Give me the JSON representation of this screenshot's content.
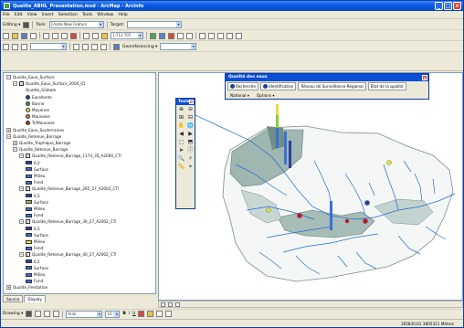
{
  "window": {
    "title": "Qualite_ABHL_Presentation.mxd - ArcMap - ArcInfo",
    "controls": [
      "_",
      "□",
      "×"
    ]
  },
  "menubar": [
    "File",
    "Edit",
    "View",
    "Insert",
    "Selection",
    "Tools",
    "Window",
    "Help"
  ],
  "toolbar_editor": {
    "editor_label": "Editing ▾",
    "task_label": "Task:",
    "task_value": "Create New Feature",
    "target_label": "Target:"
  },
  "toolbar_standard": {
    "scale_value": "1:713 707"
  },
  "toolbar_geo": {
    "georef_label": "Georeferencing ▾"
  },
  "toc": {
    "rows": [
      {
        "indent": 0,
        "expander": "−",
        "check": "",
        "label": "Qualite_Eaux_Surface",
        "symbol": ""
      },
      {
        "indent": 1,
        "expander": "−",
        "check": "✓",
        "label": "Qualite_Eaux_Surface_2000_01",
        "symbol": ""
      },
      {
        "indent": 3,
        "expander": "",
        "check": "",
        "label": "Qualite_Globale",
        "symbol": ""
      },
      {
        "indent": 3,
        "expander": "",
        "check": "",
        "label": "Excellente",
        "symbol": "dot",
        "color": "#2d3f9a"
      },
      {
        "indent": 3,
        "expander": "",
        "check": "",
        "label": "Bonne",
        "symbol": "dot",
        "color": "#3b9b3b"
      },
      {
        "indent": 3,
        "expander": "",
        "check": "",
        "label": "Moyenne",
        "symbol": "dot",
        "color": "#e8e83c"
      },
      {
        "indent": 3,
        "expander": "",
        "check": "",
        "label": "Mauvaise",
        "symbol": "dot",
        "color": "#e07a2c"
      },
      {
        "indent": 3,
        "expander": "",
        "check": "",
        "label": "Tr/Mauvaise",
        "symbol": "dot",
        "color": "#cc2a2a"
      },
      {
        "indent": 0,
        "expander": "+",
        "check": "",
        "label": "Qualite_Eaux_Souterraines",
        "symbol": ""
      },
      {
        "indent": 0,
        "expander": "−",
        "check": "",
        "label": "Qualite_Retenue_Barrage",
        "symbol": ""
      },
      {
        "indent": 1,
        "expander": "+",
        "check": "",
        "label": "Qualite_Trophique_Barrage",
        "symbol": ""
      },
      {
        "indent": 1,
        "expander": "−",
        "check": "",
        "label": "Qualite_Retenue_Barrage",
        "symbol": ""
      },
      {
        "indent": 2,
        "expander": "−",
        "check": "✓",
        "label": "Qualite_Retenue_Barrage_1174_35_A2000_CTl",
        "symbol": ""
      },
      {
        "indent": 3,
        "expander": "",
        "check": "",
        "label": "6,5",
        "symbol": "sq",
        "color": "#2d3f9a"
      },
      {
        "indent": 3,
        "expander": "",
        "check": "",
        "label": "Surface",
        "symbol": "sq",
        "color": "#3c6fd8"
      },
      {
        "indent": 3,
        "expander": "",
        "check": "",
        "label": "Milieu",
        "symbol": "sq",
        "color": "#3c6fd8"
      },
      {
        "indent": 3,
        "expander": "",
        "check": "",
        "label": "Fond",
        "symbol": "sq",
        "color": "#3c6fd8"
      },
      {
        "indent": 2,
        "expander": "−",
        "check": "✓",
        "label": "Qualite_Retenue_Barrage_265_27_A2002_CTl",
        "symbol": ""
      },
      {
        "indent": 3,
        "expander": "",
        "check": "",
        "label": "6,5",
        "symbol": "sq",
        "color": "#2d3f9a"
      },
      {
        "indent": 3,
        "expander": "",
        "check": "",
        "label": "Surface",
        "symbol": "sq",
        "color": "#8fce3c"
      },
      {
        "indent": 3,
        "expander": "",
        "check": "",
        "label": "Milieu",
        "symbol": "sq",
        "color": "#3c6fd8"
      },
      {
        "indent": 3,
        "expander": "",
        "check": "",
        "label": "Fond",
        "symbol": "sq",
        "color": "#3c6fd8"
      },
      {
        "indent": 2,
        "expander": "−",
        "check": "✓",
        "label": "Qualite_Retenue_Barrage_36_27_A2002_CTl",
        "symbol": ""
      },
      {
        "indent": 3,
        "expander": "",
        "check": "",
        "label": "6,5",
        "symbol": "sq",
        "color": "#2d3f9a"
      },
      {
        "indent": 3,
        "expander": "",
        "check": "",
        "label": "Surface",
        "symbol": "sq",
        "color": "#3c6fd8"
      },
      {
        "indent": 3,
        "expander": "",
        "check": "",
        "label": "Milieu",
        "symbol": "sq",
        "color": "#e8e83c"
      },
      {
        "indent": 3,
        "expander": "",
        "check": "",
        "label": "Fond",
        "symbol": "sq",
        "color": "#3c6fd8"
      },
      {
        "indent": 2,
        "expander": "−",
        "check": "✓",
        "label": "Qualite_Retenue_Barrage_40_27_A2002_CTl",
        "symbol": ""
      },
      {
        "indent": 3,
        "expander": "",
        "check": "",
        "label": "6,5",
        "symbol": "sq",
        "color": "#2d3f9a"
      },
      {
        "indent": 3,
        "expander": "",
        "check": "",
        "label": "Surface",
        "symbol": "sq",
        "color": "#3c6fd8"
      },
      {
        "indent": 3,
        "expander": "",
        "check": "",
        "label": "Milieu",
        "symbol": "sq",
        "color": "#3c6fd8"
      },
      {
        "indent": 3,
        "expander": "",
        "check": "",
        "label": "Fond",
        "symbol": "sq",
        "color": "#3c6fd8"
      },
      {
        "indent": 0,
        "expander": "+",
        "check": "",
        "label": "Qualite_Prestation",
        "symbol": ""
      }
    ],
    "tabs": [
      "Source",
      "Display"
    ]
  },
  "tools_panel": {
    "title": "Tools",
    "close": "×",
    "icons": [
      "zoom-in-icon",
      "zoom-out-icon",
      "fixed-zoom-in-icon",
      "fixed-zoom-out-icon",
      "pan-icon",
      "full-extent-icon",
      "back-extent-icon",
      "forward-extent-icon",
      "select-features-icon",
      "select-elements-icon",
      "pointer-icon",
      "identify-icon",
      "find-icon",
      "hyperlink-icon",
      "measure-icon",
      "goto-xy-icon"
    ],
    "glyphs": [
      "⊕",
      "⊖",
      "⊞",
      "⊟",
      "✋",
      "🌐",
      "◀",
      "▶",
      "⬚",
      "⬒",
      "➤",
      "ⓘ",
      "🔍",
      "⚡",
      "📏",
      "⌖"
    ]
  },
  "query_panel": {
    "title": "Qualité des eaux",
    "close": "×",
    "buttons": [
      "Recherche",
      "Identification",
      "Réseau de Surveillance Régional",
      "État de la qualité"
    ],
    "menus": [
      "National ▾",
      "Options ▾"
    ]
  },
  "drawing": {
    "label": "Drawing ▾",
    "font": "Arial",
    "size": "10",
    "bold": "B",
    "italic": "I",
    "underline": "U"
  },
  "status": {
    "coords": "165830,61 3805311 Mètres"
  },
  "colors": {
    "xp_blue": "#0a5ce6",
    "basin_fill": "#b9c9c6",
    "basin_dark": "#6f8f88",
    "river": "#1f6fd0",
    "point_red": "#b41c30",
    "point_blue": "#2e3f9e",
    "point_yellow": "#e0e03a"
  }
}
